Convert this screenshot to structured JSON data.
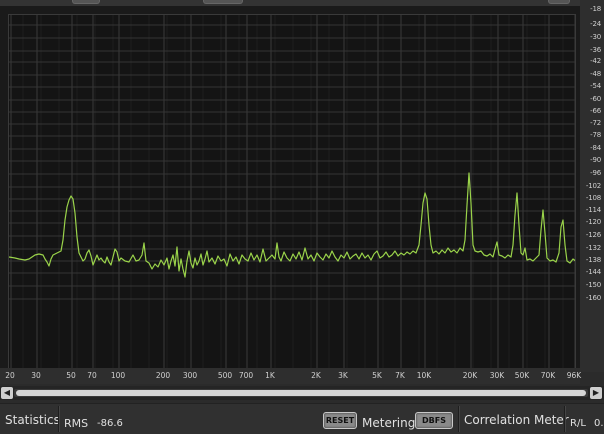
{
  "plot": {
    "trace_color": "#9ad34a",
    "y_ticks": [
      "-18",
      "-24",
      "-30",
      "-36",
      "-42",
      "-48",
      "-54",
      "-60",
      "-66",
      "-72",
      "-78",
      "-84",
      "-90",
      "-96",
      "-102",
      "-108",
      "-114",
      "-120",
      "-126",
      "-132",
      "-138",
      "-144",
      "-150",
      "-160"
    ],
    "x_ticks": [
      "20",
      "30",
      "50",
      "70",
      "100",
      "200",
      "300",
      "500",
      "700",
      "1K",
      "2K",
      "3K",
      "5K",
      "7K",
      "10K",
      "20K",
      "30K",
      "50K",
      "70K",
      "96K"
    ]
  },
  "status": {
    "statistics_label": "Statistics",
    "rms_label": "RMS",
    "rms_value": "-86.6",
    "reset_label": "RESET",
    "metering_label": "Metering",
    "dbfs_label": "DBFS",
    "correlation_label": "Correlation Meter",
    "rl_label": "R/L",
    "rl_value": "0."
  }
}
